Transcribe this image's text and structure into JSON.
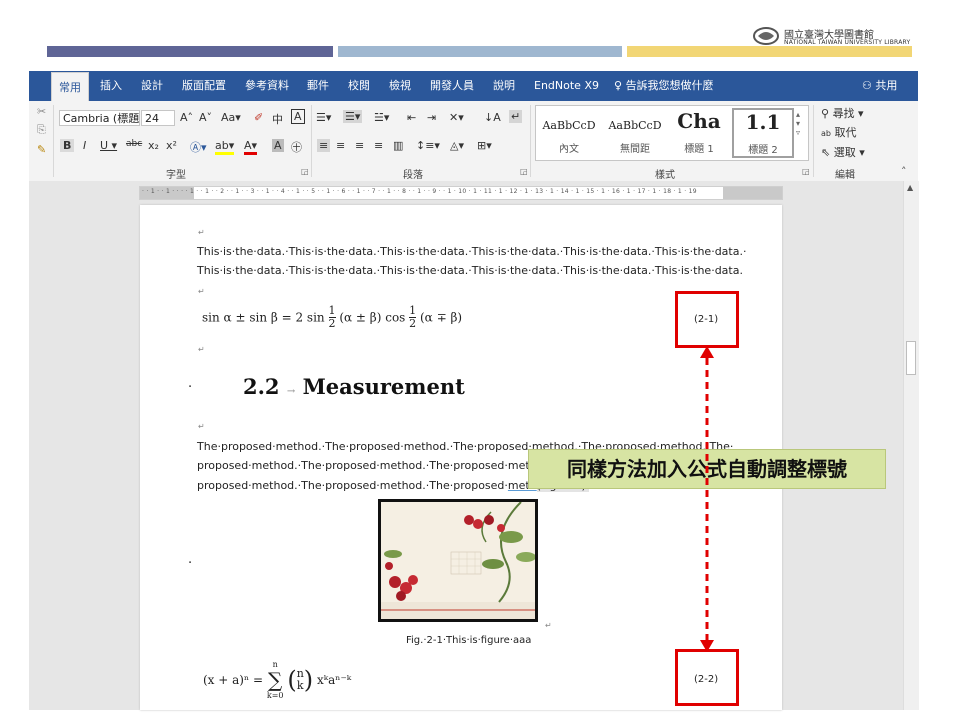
{
  "header": {
    "logo_zh": "國立臺灣大學圖書館",
    "logo_en": "NATIONAL TAIWAN UNIVERSITY LIBRARY",
    "colors": {
      "bar1": "#5f6596",
      "bar2": "#9fb7d0",
      "bar3": "#f2d675"
    }
  },
  "ribbon": {
    "tabs": [
      "常用",
      "插入",
      "設計",
      "版面配置",
      "參考資料",
      "郵件",
      "校閱",
      "檢視",
      "開發人員",
      "說明",
      "EndNote X9"
    ],
    "active_tab": "常用",
    "tell_me": "告訴我您想做什麼",
    "share": "共用",
    "font_name": "Cambria (標題",
    "font_size": "24",
    "group_font": "字型",
    "group_paragraph": "段落",
    "group_styles": "樣式",
    "group_editing": "編輯",
    "styles": [
      {
        "sample": "AaBbCcD",
        "name": "內文"
      },
      {
        "sample": "AaBbCcD",
        "name": "無間距"
      },
      {
        "sample": "Cha",
        "name": "標題 1"
      },
      {
        "sample": "1.1",
        "name": "標題 2"
      }
    ],
    "find": "尋找",
    "replace": "取代",
    "select": "選取",
    "brand_color": "#2b579a"
  },
  "ruler": {
    "text": "· · 1 · · 1 · ·   · · 1 · · 1 · · 2 · · 1 · · 3 · · 1 · · 4 · · 1 · · 5 · · 1 · · 6 · · 1 · · 7 · · 1 · · 8 · · 1 · · 9 · · 1 · 10 · 1 · 11 · 1 · 12 · 1 · 13 · 1 · 14 · 1 · 15 · 1 · 16 · 1 · 17 · 1 · 18 · 1 · 19"
  },
  "document": {
    "data_line1": "This·is·the·data.·This·is·the·data.·This·is·the·data.·This·is·the·data.·This·is·the·data.·This·is·the·data.·",
    "data_line2": "This·is·the·data.·This·is·the·data.·This·is·the·data.·This·is·the·data.·This·is·the·data.·This·is·the·data.",
    "eq1_left": "sin α ± sin β = 2 sin",
    "eq1_mid1": "(α ± β) cos",
    "eq1_mid2": "(α ∓ β)",
    "frac_num": "1",
    "frac_den": "2",
    "eq1_number": "(2-1)",
    "heading_number": "2.2",
    "heading_title": "Measurement",
    "method_line1": "The·proposed·method.·The·proposed·method.·The·proposed·method.·The·proposed·method.·The·",
    "method_line2": "proposed·method.·The·proposed·method.·The·proposed·meth",
    "method_line3_a": "proposed·method.·The·proposed·method.·The·proposed·",
    "method_line3_b": "meth",
    "method_line3_c": "(Fig. 2-1).",
    "figure_caption": "Fig.·2-1·This·is·figure·aaa",
    "eq2": "(x + a)ⁿ = ",
    "eq2_sum_top": "n",
    "eq2_sum_bottom": "k=0",
    "eq2_binom_top": "n",
    "eq2_binom_bottom": "k",
    "eq2_rest": "xᵏaⁿ⁻ᵏ",
    "eq2_number": "(2-2)"
  },
  "callout": {
    "text": "同樣方法加入公式自動調整標號",
    "color": "#d7e4a3"
  },
  "annotation_color": "#e00000"
}
